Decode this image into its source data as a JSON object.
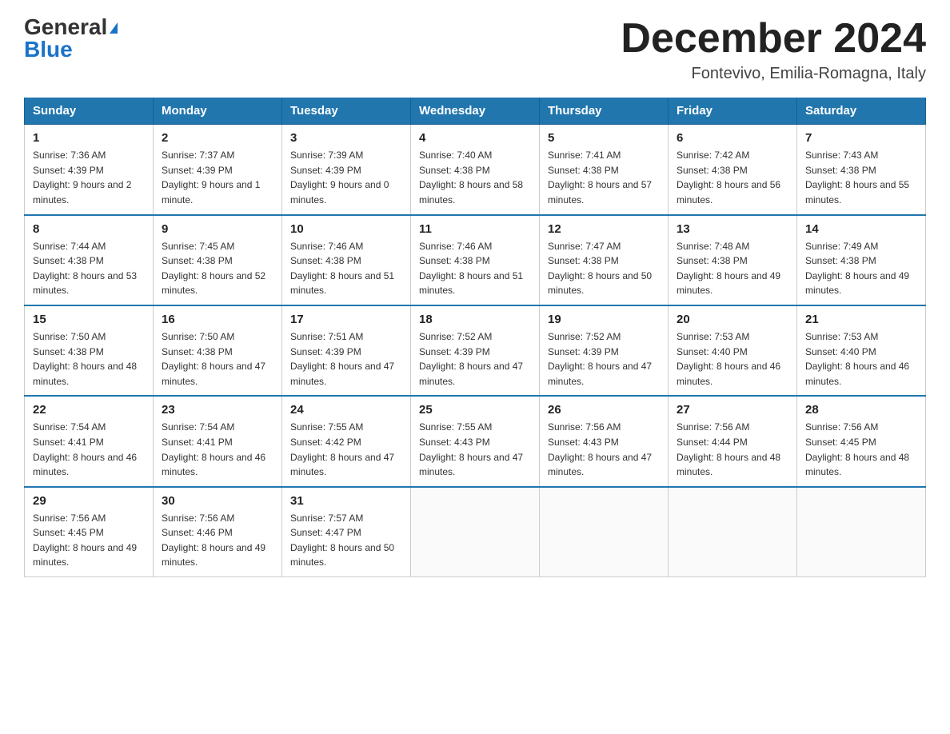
{
  "logo": {
    "general": "General",
    "blue": "Blue"
  },
  "header": {
    "title": "December 2024",
    "location": "Fontevivo, Emilia-Romagna, Italy"
  },
  "days_of_week": [
    "Sunday",
    "Monday",
    "Tuesday",
    "Wednesday",
    "Thursday",
    "Friday",
    "Saturday"
  ],
  "weeks": [
    [
      {
        "day": "1",
        "sunrise": "7:36 AM",
        "sunset": "4:39 PM",
        "daylight": "9 hours and 2 minutes."
      },
      {
        "day": "2",
        "sunrise": "7:37 AM",
        "sunset": "4:39 PM",
        "daylight": "9 hours and 1 minute."
      },
      {
        "day": "3",
        "sunrise": "7:39 AM",
        "sunset": "4:39 PM",
        "daylight": "9 hours and 0 minutes."
      },
      {
        "day": "4",
        "sunrise": "7:40 AM",
        "sunset": "4:38 PM",
        "daylight": "8 hours and 58 minutes."
      },
      {
        "day": "5",
        "sunrise": "7:41 AM",
        "sunset": "4:38 PM",
        "daylight": "8 hours and 57 minutes."
      },
      {
        "day": "6",
        "sunrise": "7:42 AM",
        "sunset": "4:38 PM",
        "daylight": "8 hours and 56 minutes."
      },
      {
        "day": "7",
        "sunrise": "7:43 AM",
        "sunset": "4:38 PM",
        "daylight": "8 hours and 55 minutes."
      }
    ],
    [
      {
        "day": "8",
        "sunrise": "7:44 AM",
        "sunset": "4:38 PM",
        "daylight": "8 hours and 53 minutes."
      },
      {
        "day": "9",
        "sunrise": "7:45 AM",
        "sunset": "4:38 PM",
        "daylight": "8 hours and 52 minutes."
      },
      {
        "day": "10",
        "sunrise": "7:46 AM",
        "sunset": "4:38 PM",
        "daylight": "8 hours and 51 minutes."
      },
      {
        "day": "11",
        "sunrise": "7:46 AM",
        "sunset": "4:38 PM",
        "daylight": "8 hours and 51 minutes."
      },
      {
        "day": "12",
        "sunrise": "7:47 AM",
        "sunset": "4:38 PM",
        "daylight": "8 hours and 50 minutes."
      },
      {
        "day": "13",
        "sunrise": "7:48 AM",
        "sunset": "4:38 PM",
        "daylight": "8 hours and 49 minutes."
      },
      {
        "day": "14",
        "sunrise": "7:49 AM",
        "sunset": "4:38 PM",
        "daylight": "8 hours and 49 minutes."
      }
    ],
    [
      {
        "day": "15",
        "sunrise": "7:50 AM",
        "sunset": "4:38 PM",
        "daylight": "8 hours and 48 minutes."
      },
      {
        "day": "16",
        "sunrise": "7:50 AM",
        "sunset": "4:38 PM",
        "daylight": "8 hours and 47 minutes."
      },
      {
        "day": "17",
        "sunrise": "7:51 AM",
        "sunset": "4:39 PM",
        "daylight": "8 hours and 47 minutes."
      },
      {
        "day": "18",
        "sunrise": "7:52 AM",
        "sunset": "4:39 PM",
        "daylight": "8 hours and 47 minutes."
      },
      {
        "day": "19",
        "sunrise": "7:52 AM",
        "sunset": "4:39 PM",
        "daylight": "8 hours and 47 minutes."
      },
      {
        "day": "20",
        "sunrise": "7:53 AM",
        "sunset": "4:40 PM",
        "daylight": "8 hours and 46 minutes."
      },
      {
        "day": "21",
        "sunrise": "7:53 AM",
        "sunset": "4:40 PM",
        "daylight": "8 hours and 46 minutes."
      }
    ],
    [
      {
        "day": "22",
        "sunrise": "7:54 AM",
        "sunset": "4:41 PM",
        "daylight": "8 hours and 46 minutes."
      },
      {
        "day": "23",
        "sunrise": "7:54 AM",
        "sunset": "4:41 PM",
        "daylight": "8 hours and 46 minutes."
      },
      {
        "day": "24",
        "sunrise": "7:55 AM",
        "sunset": "4:42 PM",
        "daylight": "8 hours and 47 minutes."
      },
      {
        "day": "25",
        "sunrise": "7:55 AM",
        "sunset": "4:43 PM",
        "daylight": "8 hours and 47 minutes."
      },
      {
        "day": "26",
        "sunrise": "7:56 AM",
        "sunset": "4:43 PM",
        "daylight": "8 hours and 47 minutes."
      },
      {
        "day": "27",
        "sunrise": "7:56 AM",
        "sunset": "4:44 PM",
        "daylight": "8 hours and 48 minutes."
      },
      {
        "day": "28",
        "sunrise": "7:56 AM",
        "sunset": "4:45 PM",
        "daylight": "8 hours and 48 minutes."
      }
    ],
    [
      {
        "day": "29",
        "sunrise": "7:56 AM",
        "sunset": "4:45 PM",
        "daylight": "8 hours and 49 minutes."
      },
      {
        "day": "30",
        "sunrise": "7:56 AM",
        "sunset": "4:46 PM",
        "daylight": "8 hours and 49 minutes."
      },
      {
        "day": "31",
        "sunrise": "7:57 AM",
        "sunset": "4:47 PM",
        "daylight": "8 hours and 50 minutes."
      },
      null,
      null,
      null,
      null
    ]
  ]
}
